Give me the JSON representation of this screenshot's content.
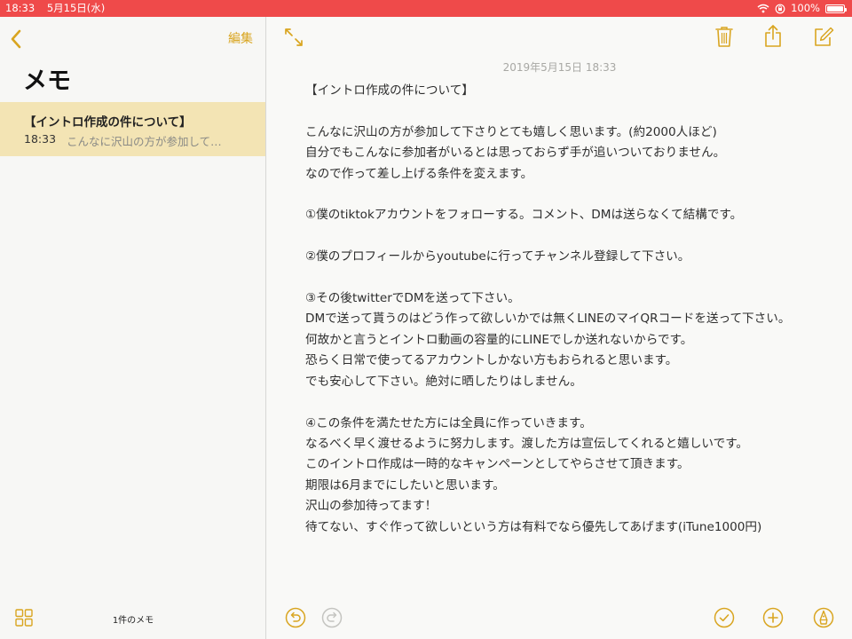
{
  "status_bar": {
    "time": "18:33",
    "date": "5月15日(水)",
    "battery": "100%",
    "battery_level": 1.0
  },
  "sidebar": {
    "edit_label": "編集",
    "title": "メモ",
    "note": {
      "title": "【イントロ作成の件について】",
      "time": "18:33",
      "preview": "こんなに沢山の方が参加して…"
    },
    "note_count": "1件のメモ"
  },
  "note": {
    "date": "2019年5月15日 18:33",
    "lines": [
      "【イントロ作成の件について】",
      "",
      "こんなに沢山の方が参加して下さりとても嬉しく思います。(約2000人ほど)",
      "自分でもこんなに参加者がいるとは思っておらず手が追いついておりません。",
      "なので作って差し上げる条件を変えます。",
      "",
      "①僕のtiktokアカウントをフォローする。コメント、DMは送らなくて結構です。",
      "",
      "②僕のプロフィールからyoutubeに行ってチャンネル登録して下さい。",
      "",
      "③その後twitterでDMを送って下さい。",
      "DMで送って貰うのはどう作って欲しいかでは無くLINEのマイQRコードを送って下さい。",
      "何故かと言うとイントロ動画の容量的にLINEでしか送れないからです。",
      "恐らく日常で使ってるアカウントしかない方もおられると思います。",
      "でも安心して下さい。絶対に晒したりはしません。",
      "",
      "④この条件を満たせた方には全員に作っていきます。",
      "なるべく早く渡せるように努力します。渡した方は宣伝してくれると嬉しいです。",
      "このイントロ作成は一時的なキャンペーンとしてやらさせて頂きます。",
      "期限は6月までにしたいと思います。",
      "沢山の参加待ってます！",
      "待てない、すぐ作って欲しいという方は有料でなら優先してあげます(iTune1000円)"
    ]
  },
  "colors": {
    "accent": "#d9a520",
    "status_bar": "#ef4a4a",
    "selected_row": "#f3e4b4",
    "background": "#f7f7f5"
  },
  "icons": [
    "back-chevron-icon",
    "grid-icon",
    "expand-icon",
    "trash-icon",
    "share-icon",
    "compose-icon",
    "undo-icon",
    "redo-icon",
    "checklist-icon",
    "add-icon",
    "markup-icon",
    "wifi-icon",
    "lock-rotation-icon",
    "battery-icon"
  ]
}
